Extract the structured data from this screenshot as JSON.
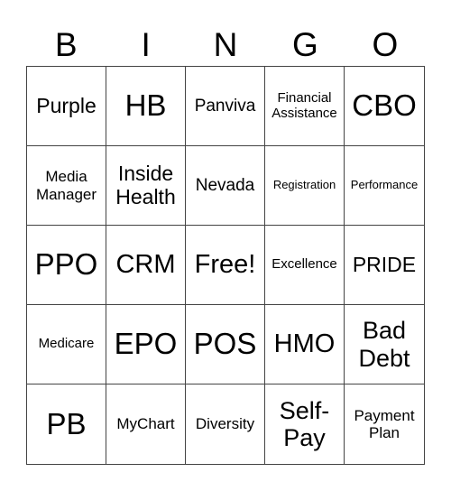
{
  "header": [
    "B",
    "I",
    "N",
    "G",
    "O"
  ],
  "cells": [
    {
      "text": "Purple",
      "size": "s23"
    },
    {
      "text": "HB",
      "size": "s33"
    },
    {
      "text": "Panviva",
      "size": "s19"
    },
    {
      "text": "Financial Assistance",
      "size": "s15"
    },
    {
      "text": "CBO",
      "size": "s33"
    },
    {
      "text": "Media Manager",
      "size": "s17"
    },
    {
      "text": "Inside Health",
      "size": "s23"
    },
    {
      "text": "Nevada",
      "size": "s19"
    },
    {
      "text": "Registration",
      "size": "s13"
    },
    {
      "text": "Performance",
      "size": "s13"
    },
    {
      "text": "PPO",
      "size": "s33"
    },
    {
      "text": "CRM",
      "size": "s30"
    },
    {
      "text": "Free!",
      "size": "s30"
    },
    {
      "text": "Excellence",
      "size": "s15"
    },
    {
      "text": "PRIDE",
      "size": "s23"
    },
    {
      "text": "Medicare",
      "size": "s15"
    },
    {
      "text": "EPO",
      "size": "s33"
    },
    {
      "text": "POS",
      "size": "s33"
    },
    {
      "text": "HMO",
      "size": "s30"
    },
    {
      "text": "Bad Debt",
      "size": "s27"
    },
    {
      "text": "PB",
      "size": "s33"
    },
    {
      "text": "MyChart",
      "size": "s17"
    },
    {
      "text": "Diversity",
      "size": "s17"
    },
    {
      "text": "Self-Pay",
      "size": "s27"
    },
    {
      "text": "Payment Plan",
      "size": "s17"
    }
  ]
}
